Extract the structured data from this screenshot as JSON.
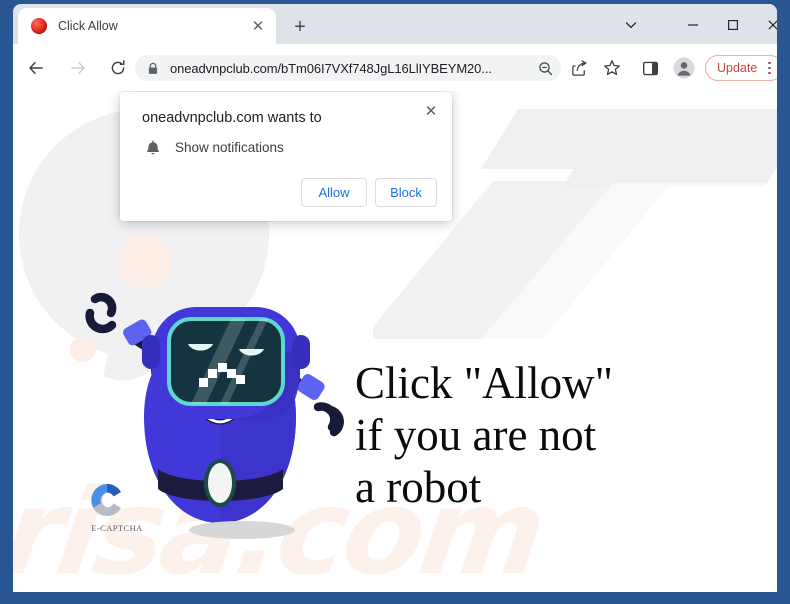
{
  "window": {
    "controls": {
      "tab_search": "chevron-down-icon",
      "minimize": "minimize-icon",
      "maximize": "maximize-icon",
      "close": "close-icon"
    }
  },
  "tabstrip": {
    "tabs": [
      {
        "title": "Click Allow",
        "favicon": "red-circle-favicon",
        "close_label": "✕"
      }
    ],
    "new_tab_label": "+"
  },
  "toolbar": {
    "back": "back-arrow-icon",
    "forward": "forward-arrow-icon",
    "reload": "reload-icon",
    "omnibox": {
      "lock": "lock-icon",
      "url": "oneadvnpclub.com/bTm06I7VXf748JgL16LlIYBEYM20...",
      "zoom": "zoom-search-icon"
    },
    "share": "share-icon",
    "bookmark": "star-icon",
    "side_panel": "side-panel-icon",
    "profile": "profile-avatar-icon",
    "update_label": "Update",
    "menu": "three-dot-menu-icon",
    "accent_color": "#c5483f"
  },
  "permission_dialog": {
    "title": "oneadvnpclub.com wants to",
    "close_label": "✕",
    "item_icon": "bell-icon",
    "item_label": "Show notifications",
    "allow_label": "Allow",
    "block_label": "Block",
    "button_text_color": "#1a73e8"
  },
  "page": {
    "headline_line1": "Click \"Allow\"",
    "headline_line2": "if you are not",
    "headline_line3": "a robot",
    "watermark_text": "risa.com",
    "watermark_color": "#fdf1ec",
    "brand_label": "E-CAPTCHA",
    "robot": {
      "body_color": "#4038d8",
      "body_color_dark": "#3a31c4",
      "screen_color": "#153440",
      "screen_border_color": "#5fd6cf",
      "limb_color": "#171a38"
    }
  }
}
